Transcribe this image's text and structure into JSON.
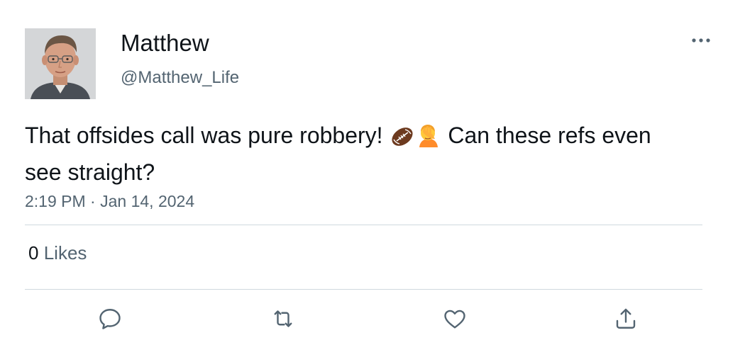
{
  "author": {
    "display_name": "Matthew",
    "handle": "@Matthew_Life",
    "avatar_icon": "avatar-photo"
  },
  "tweet": {
    "text_part1": "That offsides call was pure robbery! ",
    "emoji_1": "american-football",
    "emoji_2": "face-palm",
    "text_part2": " Can these refs even see straight?",
    "time": "2:19 PM",
    "separator": "·",
    "date": "Jan 14, 2024"
  },
  "stats": {
    "likes_count": "0",
    "likes_label": "Likes"
  },
  "actions": {
    "reply_icon": "reply-icon",
    "retweet_icon": "retweet-icon",
    "like_icon": "heart-icon",
    "share_icon": "share-icon",
    "more_icon": "more-icon"
  },
  "colors": {
    "text_primary": "#0f1419",
    "text_secondary": "#536471",
    "divider": "#cfd9de",
    "football_brown": "#6d3a1f",
    "face_yellow": "#ffc93a"
  }
}
